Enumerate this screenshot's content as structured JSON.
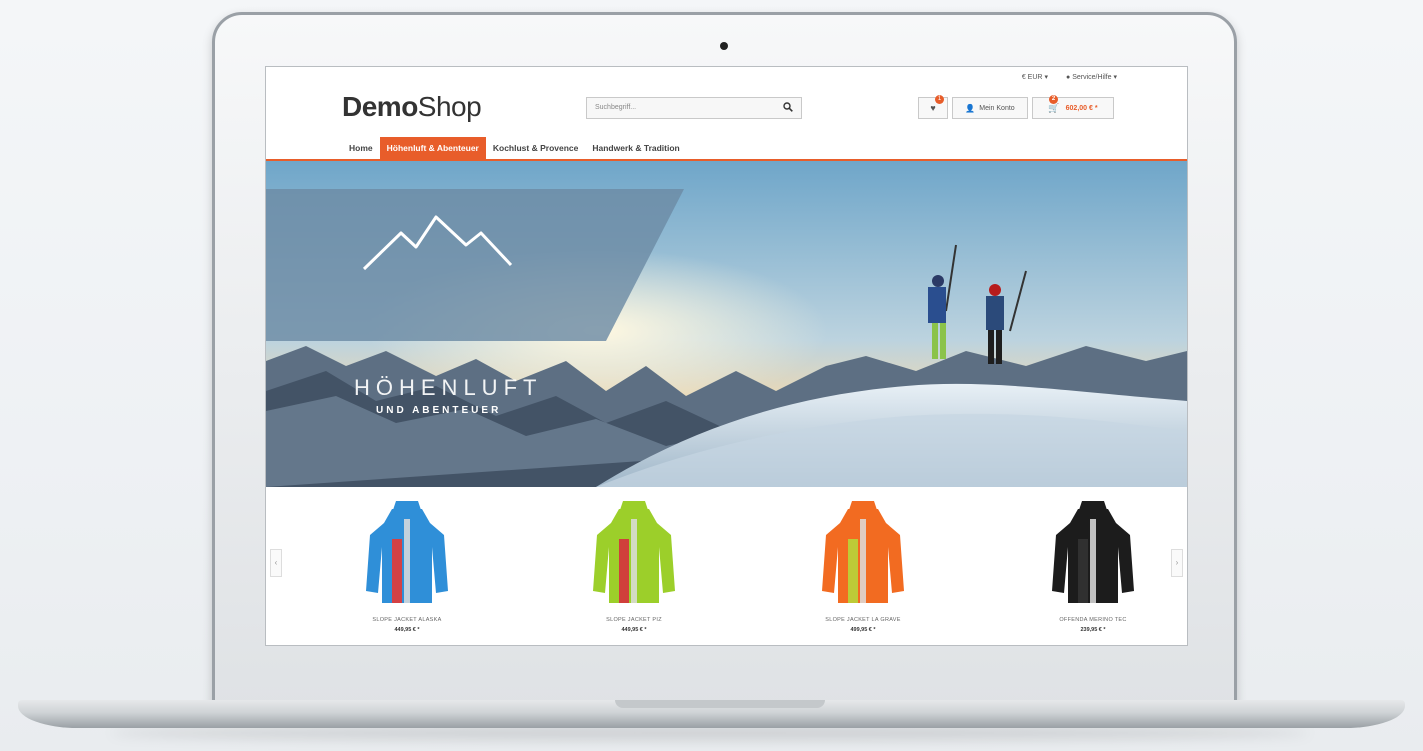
{
  "brand": {
    "bold": "Demo",
    "light": "Shop",
    "accent": "#e85d2a"
  },
  "meta": {
    "currency": "€ EUR",
    "service": "Service/Hilfe"
  },
  "search": {
    "placeholder": "Suchbegriff..."
  },
  "header": {
    "wishlist_count": "1",
    "account_label": "Mein Konto",
    "cart_count": "2",
    "cart_total": "602,00 € *"
  },
  "nav": [
    {
      "label": "Home"
    },
    {
      "label": "Höhenluft & Abenteuer",
      "active": true
    },
    {
      "label": "Kochlust & Provence"
    },
    {
      "label": "Handwerk & Tradition"
    }
  ],
  "hero": {
    "title": "HÖHENLUFT",
    "subtitle": "UND ABENTEUER"
  },
  "products": [
    {
      "name": "SLOPE JACKET ALASKA",
      "price": "449,95 € *",
      "colors": [
        "#2f8fd8",
        "#e53935"
      ]
    },
    {
      "name": "SLOPE JACKET PIZ",
      "price": "449,95 € *",
      "colors": [
        "#9ccf2a",
        "#d62f3d"
      ]
    },
    {
      "name": "SLOPE JACKET LA GRAVE",
      "price": "499,95 € *",
      "colors": [
        "#f26b21",
        "#b7d63a"
      ]
    },
    {
      "name": "OFFENDA MERINO TEC",
      "price": "239,95 € *",
      "colors": [
        "#1c1c1c",
        "#333333"
      ]
    }
  ]
}
